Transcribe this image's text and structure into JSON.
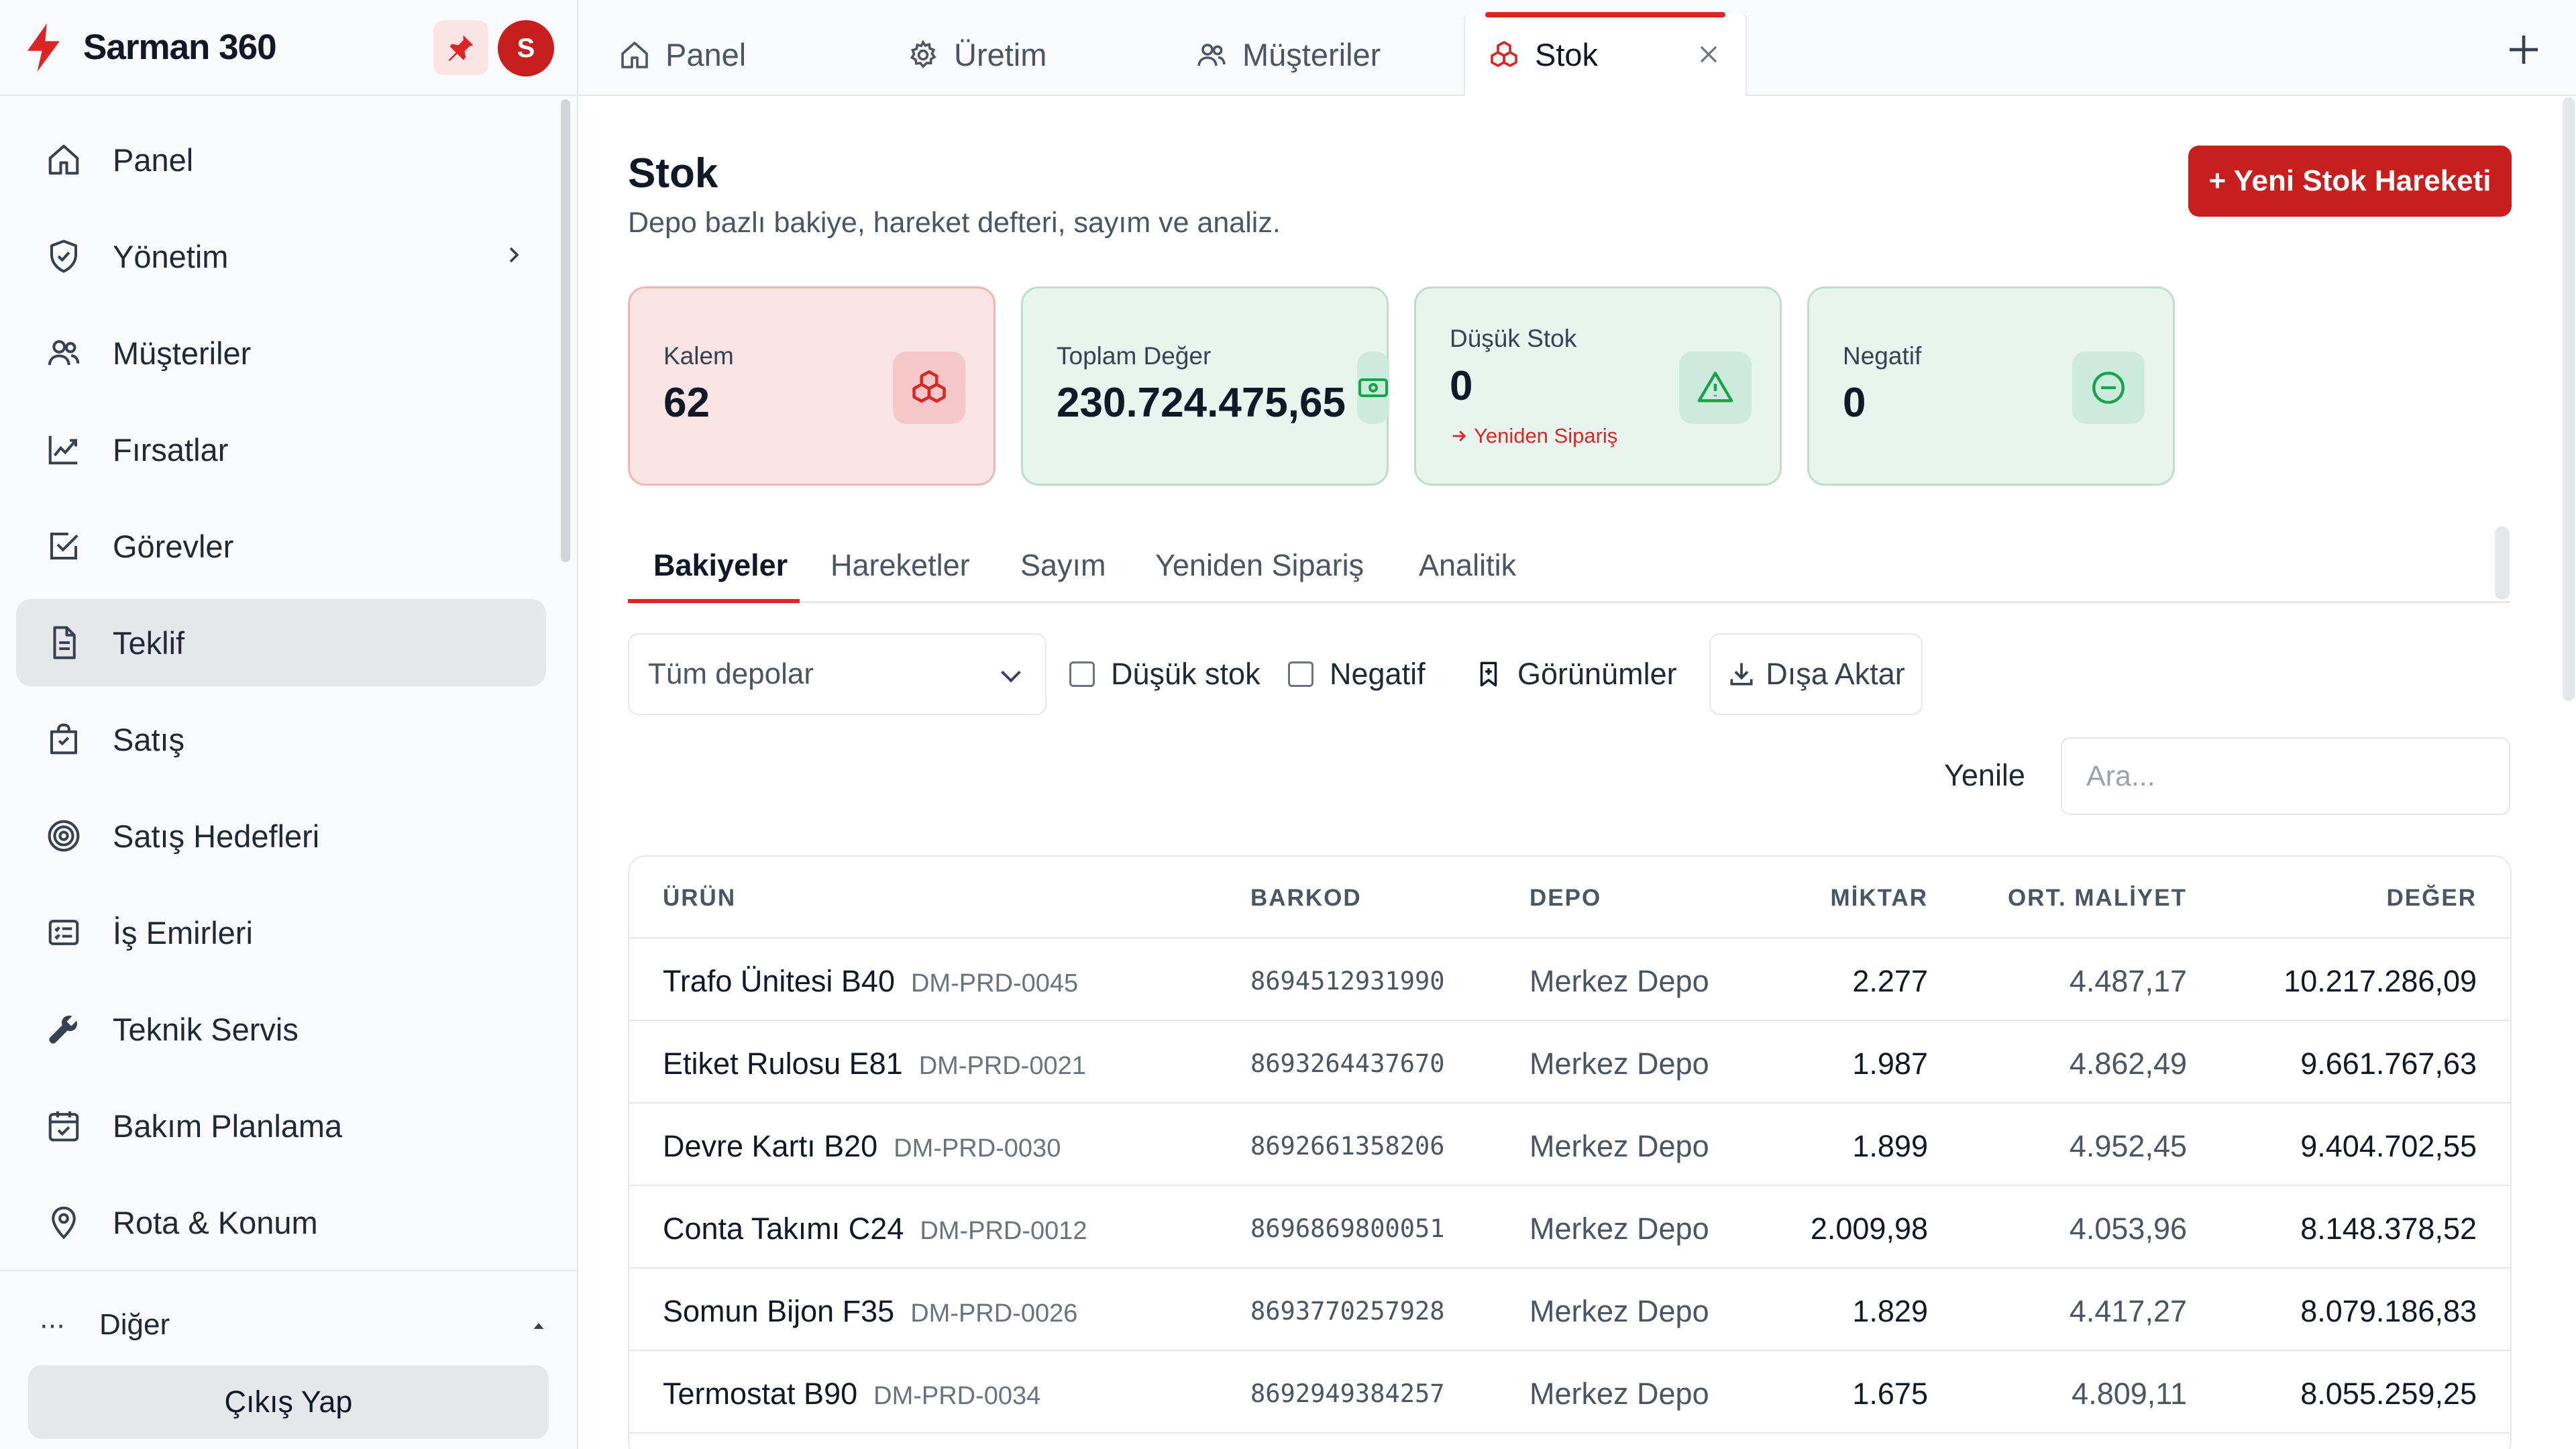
{
  "brand": {
    "title": "Sarman 360",
    "avatar_initial": "S",
    "accent": "#c81e1e"
  },
  "sidebar": {
    "items": [
      {
        "label": "Panel",
        "icon": "home-icon"
      },
      {
        "label": "Yönetim",
        "icon": "shield-icon",
        "has_submenu": true
      },
      {
        "label": "Müşteriler",
        "icon": "users-icon"
      },
      {
        "label": "Fırsatlar",
        "icon": "trend-chart-icon"
      },
      {
        "label": "Görevler",
        "icon": "checkbox-icon"
      },
      {
        "label": "Teklif",
        "icon": "document-icon",
        "active": true
      },
      {
        "label": "Satış",
        "icon": "shopping-bag-icon"
      },
      {
        "label": "Satış Hedefleri",
        "icon": "target-icon"
      },
      {
        "label": "İş Emirleri",
        "icon": "list-card-icon"
      },
      {
        "label": "Teknik Servis",
        "icon": "wrench-icon"
      },
      {
        "label": "Bakım Planlama",
        "icon": "calendar-check-icon"
      },
      {
        "label": "Rota & Konum",
        "icon": "map-pin-icon"
      }
    ],
    "other_dots": "···",
    "other_label": "Diğer",
    "logout_label": "Çıkış Yap"
  },
  "tabs": [
    {
      "label": "Panel",
      "icon": "home-icon"
    },
    {
      "label": "Üretim",
      "icon": "gear-icon"
    },
    {
      "label": "Müşteriler",
      "icon": "users-icon"
    },
    {
      "label": "Stok",
      "icon": "boxes-icon",
      "active": true
    }
  ],
  "page": {
    "title": "Stok",
    "subtitle": "Depo bazlı bakiye, hareket defteri, sayım ve analiz.",
    "new_button": "+ Yeni Stok Hareketi"
  },
  "cards": [
    {
      "label": "Kalem",
      "value": "62",
      "icon": "boxes-icon",
      "tone": "red"
    },
    {
      "label": "Toplam Değer",
      "value": "230.724.475,65",
      "icon": "cash-icon",
      "tone": "green"
    },
    {
      "label": "Düşük Stok",
      "value": "0",
      "icon": "warning-icon",
      "tone": "green",
      "link": "Yeniden Sipariş"
    },
    {
      "label": "Negatif",
      "value": "0",
      "icon": "minus-circle-icon",
      "tone": "green"
    }
  ],
  "subtabs": [
    "Bakiyeler",
    "Hareketler",
    "Sayım",
    "Yeniden Sipariş",
    "Analitik"
  ],
  "filters": {
    "warehouse_select": "Tüm depolar",
    "low_stock": "Düşük stok",
    "negative": "Negatif",
    "views": "Görünümler",
    "export": "Dışa Aktar",
    "refresh": "Yenile",
    "search_placeholder": "Ara..."
  },
  "table": {
    "columns": [
      "ÜRÜN",
      "BARKOD",
      "DEPO",
      "MİKTAR",
      "ORT. MALİYET",
      "DEĞER"
    ],
    "rows": [
      {
        "product": "Trafo Ünitesi B40",
        "code": "DM-PRD-0045",
        "barcode": "8694512931990",
        "depot": "Merkez Depo",
        "qty": "2.277",
        "cost": "4.487,17",
        "value": "10.217.286,09"
      },
      {
        "product": "Etiket Rulosu E81",
        "code": "DM-PRD-0021",
        "barcode": "8693264437670",
        "depot": "Merkez Depo",
        "qty": "1.987",
        "cost": "4.862,49",
        "value": "9.661.767,63"
      },
      {
        "product": "Devre Kartı B20",
        "code": "DM-PRD-0030",
        "barcode": "8692661358206",
        "depot": "Merkez Depo",
        "qty": "1.899",
        "cost": "4.952,45",
        "value": "9.404.702,55"
      },
      {
        "product": "Conta Takımı C24",
        "code": "DM-PRD-0012",
        "barcode": "8696869800051",
        "depot": "Merkez Depo",
        "qty": "2.009,98",
        "cost": "4.053,96",
        "value": "8.148.378,52"
      },
      {
        "product": "Somun Bijon F35",
        "code": "DM-PRD-0026",
        "barcode": "8693770257928",
        "depot": "Merkez Depo",
        "qty": "1.829",
        "cost": "4.417,27",
        "value": "8.079.186,83"
      },
      {
        "product": "Termostat B90",
        "code": "DM-PRD-0034",
        "barcode": "8692949384257",
        "depot": "Merkez Depo",
        "qty": "1.675",
        "cost": "4.809,11",
        "value": "8.055.259,25"
      }
    ]
  }
}
